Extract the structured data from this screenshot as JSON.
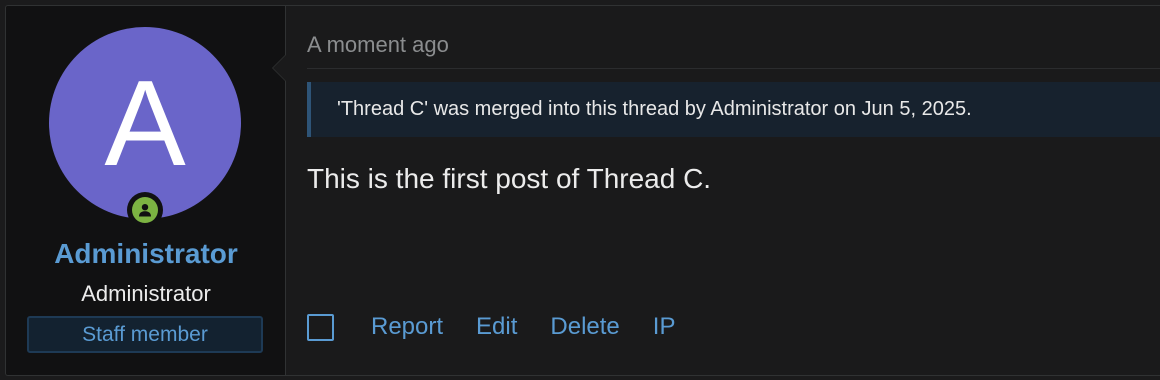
{
  "user": {
    "avatar_letter": "A",
    "avatar_color": "#6a65c9",
    "online_status_icon": "user-circle-icon",
    "online_color": "#7cb342",
    "name": "Administrator",
    "title": "Administrator",
    "banner": "Staff member"
  },
  "post": {
    "timestamp": "A moment ago",
    "merge_notice": "'Thread C' was merged into this thread by Administrator on Jun 5, 2025.",
    "body": "This is the first post of Thread C."
  },
  "actions": {
    "select_checkbox_icon": "checkbox-icon",
    "report": "Report",
    "edit": "Edit",
    "delete": "Delete",
    "ip": "IP"
  },
  "colors": {
    "link": "#5a9bd3",
    "background": "#1a1a1b"
  }
}
